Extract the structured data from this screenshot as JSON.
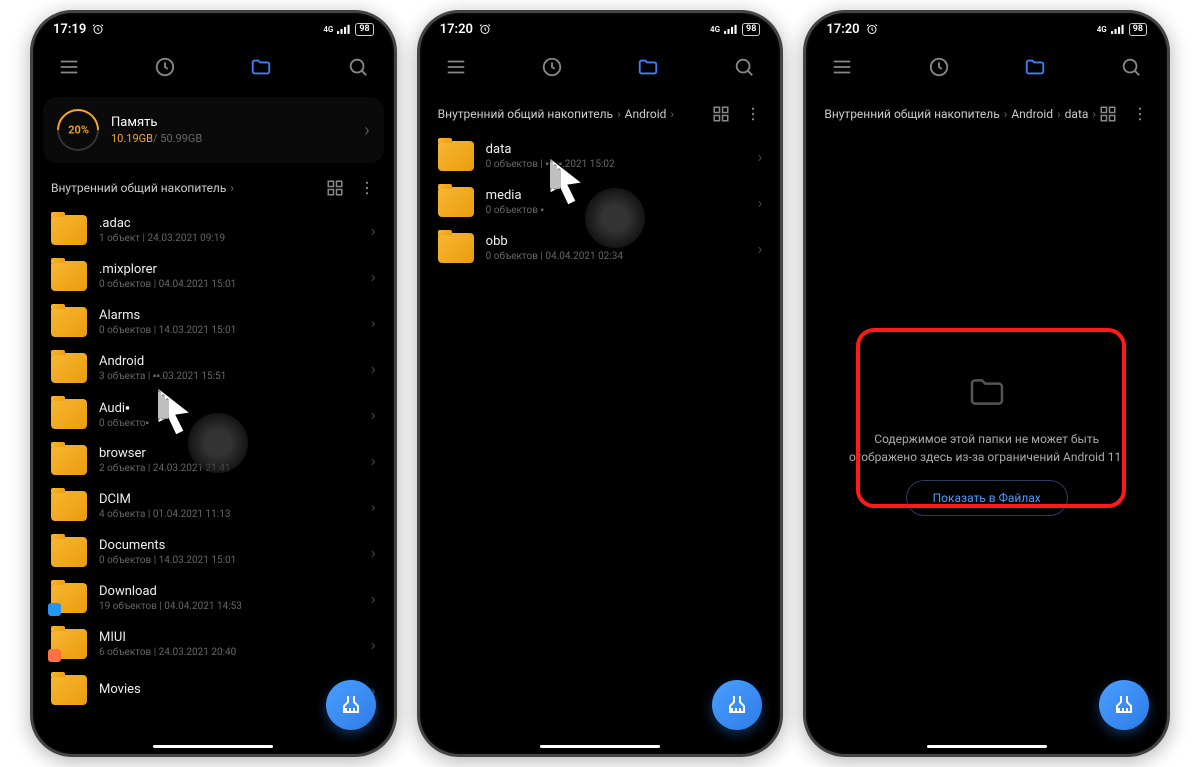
{
  "screen1": {
    "time": "17:19",
    "battery": "98",
    "storage": {
      "percent": "20%",
      "title": "Память",
      "used": "10.19GB",
      "total": "50.99GB"
    },
    "breadcrumb": [
      "Внутренний общий накопитель"
    ],
    "files": [
      {
        "name": ".adac",
        "meta": "1 объект  |  24.03.2021 09:19"
      },
      {
        "name": ".mixplorer",
        "meta": "0 объектов  |  04.04.2021 15:01"
      },
      {
        "name": "Alarms",
        "meta": "0 объектов  |  14.03.2021 15:01"
      },
      {
        "name": "Android",
        "meta": "3 объекта  |  ▪▪.03.2021 15:51"
      },
      {
        "name": "Audi▪",
        "meta": "0 объекто▪"
      },
      {
        "name": "browser",
        "meta": "2 объекта  |  24.03.2021 21:41"
      },
      {
        "name": "DCIM",
        "meta": "4 объекта  |  01.04.2021 11:13"
      },
      {
        "name": "Documents",
        "meta": "0 объектов  |  14.03.2021 15:01"
      },
      {
        "name": "Download",
        "meta": "19 объектов  |  04.04.2021 14:53",
        "badge": "blue"
      },
      {
        "name": "MIUI",
        "meta": "6 объектов  |  24.03.2021 20:40",
        "badge": "orange"
      },
      {
        "name": "Movies",
        "meta": ""
      }
    ]
  },
  "screen2": {
    "time": "17:20",
    "battery": "98",
    "breadcrumb": [
      "Внутренний общий накопитель",
      "Android"
    ],
    "files": [
      {
        "name": "data",
        "meta": "0 объектов  |  ▪▪.▪▪.2021 15:02"
      },
      {
        "name": "media",
        "meta": "0 объектов ▪"
      },
      {
        "name": "obb",
        "meta": "0 объектов  |  04.04.2021 02:34"
      }
    ]
  },
  "screen3": {
    "time": "17:20",
    "battery": "98",
    "breadcrumb": [
      "Внутренний общий накопитель",
      "Android",
      "data"
    ],
    "empty": {
      "text": "Содержимое этой папки не может быть отображено здесь из-за ограничений Android 11.",
      "button": "Показать в Файлах"
    }
  }
}
